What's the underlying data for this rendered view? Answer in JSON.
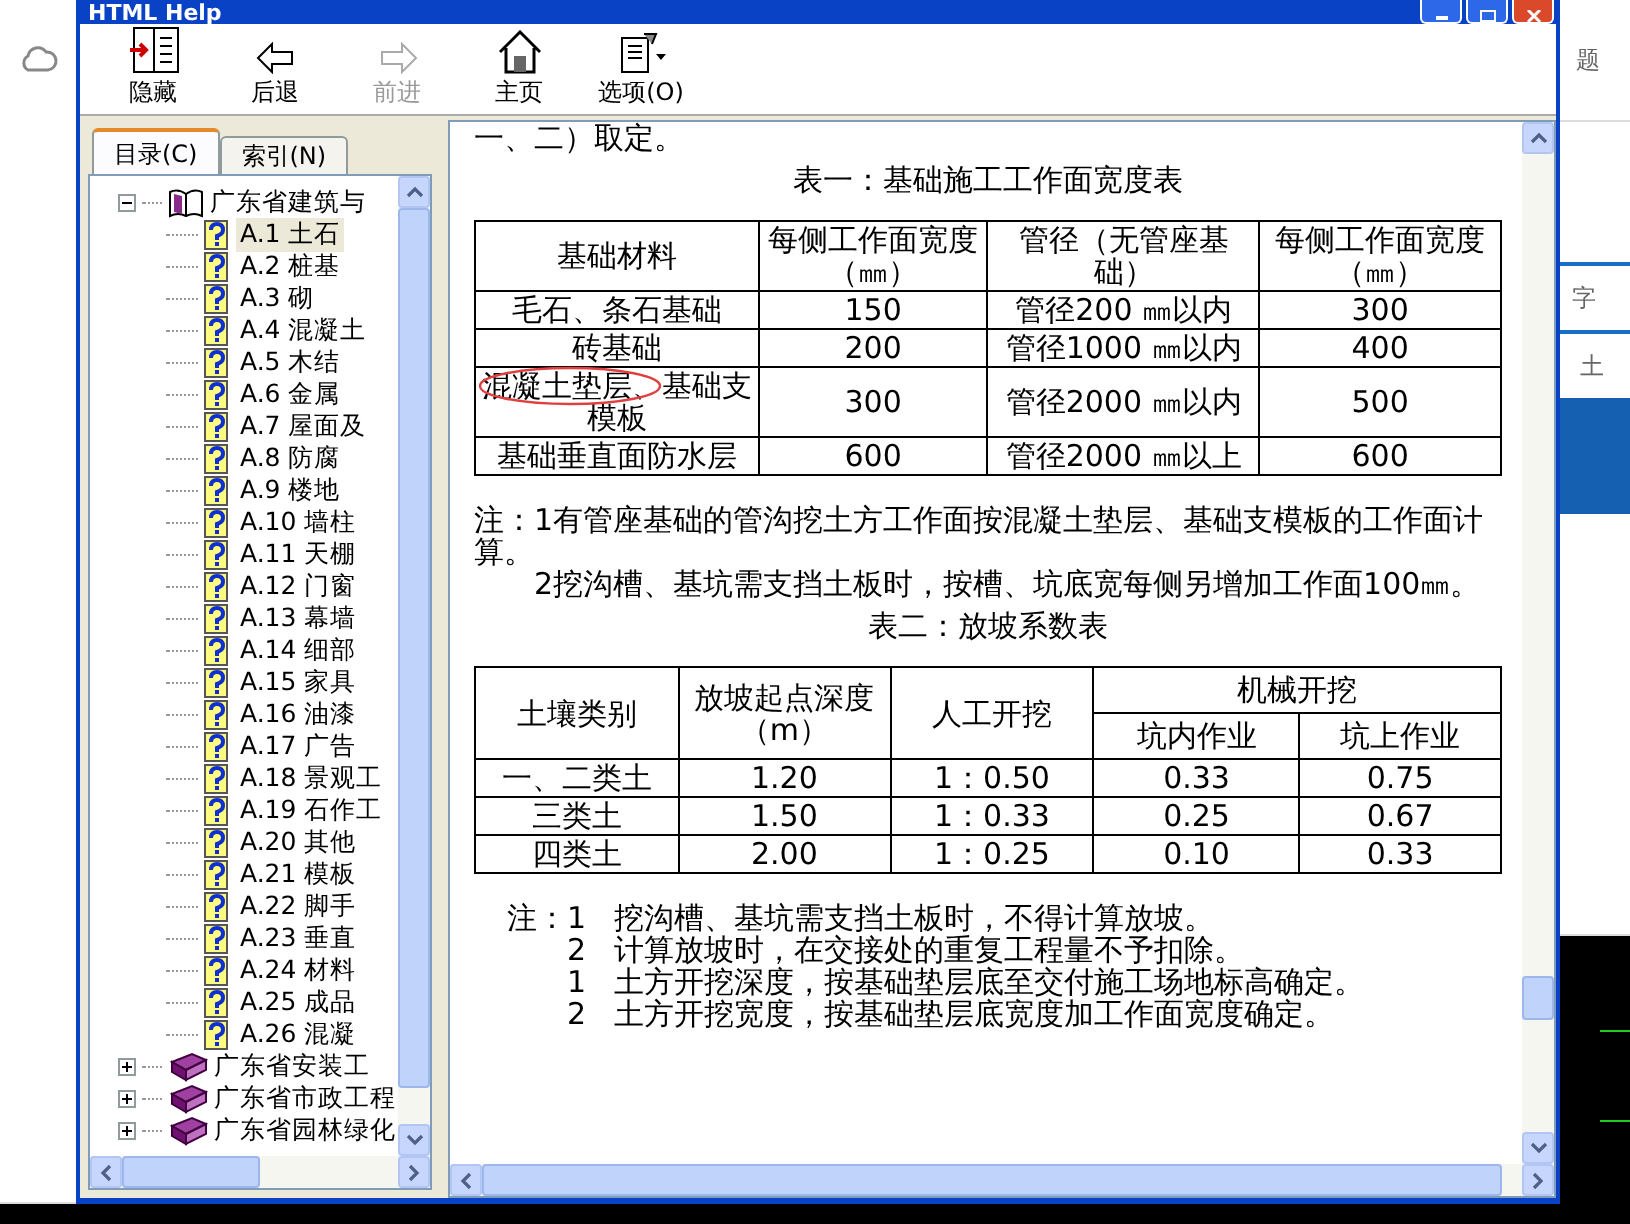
{
  "window": {
    "title": "HTML Help"
  },
  "toolbar": [
    {
      "kind": "hide",
      "label": "隐藏",
      "disabled": false
    },
    {
      "kind": "back",
      "label": "后退",
      "disabled": false
    },
    {
      "kind": "forward",
      "label": "前进",
      "disabled": true
    },
    {
      "kind": "home",
      "label": "主页",
      "disabled": false
    },
    {
      "kind": "options",
      "label": "选项(O)",
      "disabled": false
    }
  ],
  "nav_tabs": [
    {
      "label": "目录(C)",
      "selected": true
    },
    {
      "label": "索引(N)",
      "selected": false
    }
  ],
  "tree": [
    {
      "label": "广东省建筑与",
      "expanded": true,
      "children": [
        {
          "label": "A.1  土石",
          "selected": true
        },
        {
          "label": "A.2  桩基",
          "selected": false
        },
        {
          "label": "A.3  砌",
          "selected": false
        },
        {
          "label": "A.4  混凝土",
          "selected": false
        },
        {
          "label": "A.5  木结",
          "selected": false
        },
        {
          "label": "A.6  金属",
          "selected": false
        },
        {
          "label": "A.7 屋面及",
          "selected": false
        },
        {
          "label": "A.8  防腐",
          "selected": false
        },
        {
          "label": "A.9  楼地",
          "selected": false
        },
        {
          "label": "A.10  墙柱",
          "selected": false
        },
        {
          "label": "A.11  天棚",
          "selected": false
        },
        {
          "label": "A.12  门窗",
          "selected": false
        },
        {
          "label": "A.13  幕墙",
          "selected": false
        },
        {
          "label": "A.14  细部",
          "selected": false
        },
        {
          "label": "A.15  家具",
          "selected": false
        },
        {
          "label": "A.16  油漆",
          "selected": false
        },
        {
          "label": "A.17  广告",
          "selected": false
        },
        {
          "label": "A.18 景观工",
          "selected": false
        },
        {
          "label": "A.19 石作工",
          "selected": false
        },
        {
          "label": "A.20  其他",
          "selected": false
        },
        {
          "label": "A.21  模板",
          "selected": false
        },
        {
          "label": "A.22  脚手",
          "selected": false
        },
        {
          "label": "A.23  垂直",
          "selected": false
        },
        {
          "label": "A.24  材料",
          "selected": false
        },
        {
          "label": "A.25  成品",
          "selected": false
        },
        {
          "label": "A.26  混凝",
          "selected": false
        }
      ]
    },
    {
      "label": "广东省安装工",
      "expanded": false
    },
    {
      "label": "广东省市政工程",
      "expanded": false
    },
    {
      "label": "广东省园林绿化",
      "expanded": false
    }
  ],
  "content": {
    "intro": "一、二）取定。",
    "table1": {
      "title": "表一：基础施工工作面宽度表",
      "columns": [
        "基础材料",
        "每侧工作面宽度（㎜）",
        "管径（无管座基础）",
        "每侧工作面宽度（㎜）"
      ],
      "rows": [
        [
          "毛石、条石基础",
          "150",
          "管径200 ㎜以内",
          "300"
        ],
        [
          "砖基础",
          "200",
          "管径1000 ㎜以内",
          "400"
        ],
        [
          "混凝土垫层、基础支模板",
          "300",
          "管径2000 ㎜以内",
          "500"
        ],
        [
          "基础垂直面防水层",
          "600",
          "管径2000 ㎜以上",
          "600"
        ]
      ]
    },
    "note1": [
      "注：1有管座基础的管沟挖土方工作面按混凝土垫层、基础支模板的工作面计算。",
      "2挖沟槽、基坑需支挡土板时，按槽、坑底宽每侧另增加工作面100㎜。"
    ],
    "table2": {
      "title": "表二：放坡系数表",
      "header_rows": [
        [
          {
            "label": "土壤类别",
            "rowspan": 2
          },
          {
            "label": "放坡起点深度（m）",
            "rowspan": 2
          },
          {
            "label": "人工开挖",
            "rowspan": 2
          },
          {
            "label": "机械开挖",
            "colspan": 2
          }
        ],
        [
          {
            "label": "坑内作业"
          },
          {
            "label": "坑上作业"
          }
        ]
      ],
      "rows": [
        [
          "一、二类土",
          "1.20",
          "1：0.50",
          "0.33",
          "0.75"
        ],
        [
          "三类土",
          "1.50",
          "1：0.33",
          "0.25",
          "0.67"
        ],
        [
          "四类土",
          "2.00",
          "1：0.25",
          "0.10",
          "0.33"
        ]
      ]
    },
    "note2": [
      {
        "num": "注：1",
        "text": "挖沟槽、基坑需支挡土板时，不得计算放坡。"
      },
      {
        "num": "2",
        "text": "计算放坡时，在交接处的重复工程量不予扣除。"
      },
      {
        "num": "1",
        "text": "土方开挖深度，按基础垫层底至交付施工场地标高确定。"
      },
      {
        "num": "2",
        "text": "土方开挖宽度，按基础垫层底宽度加工作面宽度确定。"
      }
    ]
  },
  "background": {
    "right_texts": [
      "题",
      "字",
      "土"
    ]
  }
}
